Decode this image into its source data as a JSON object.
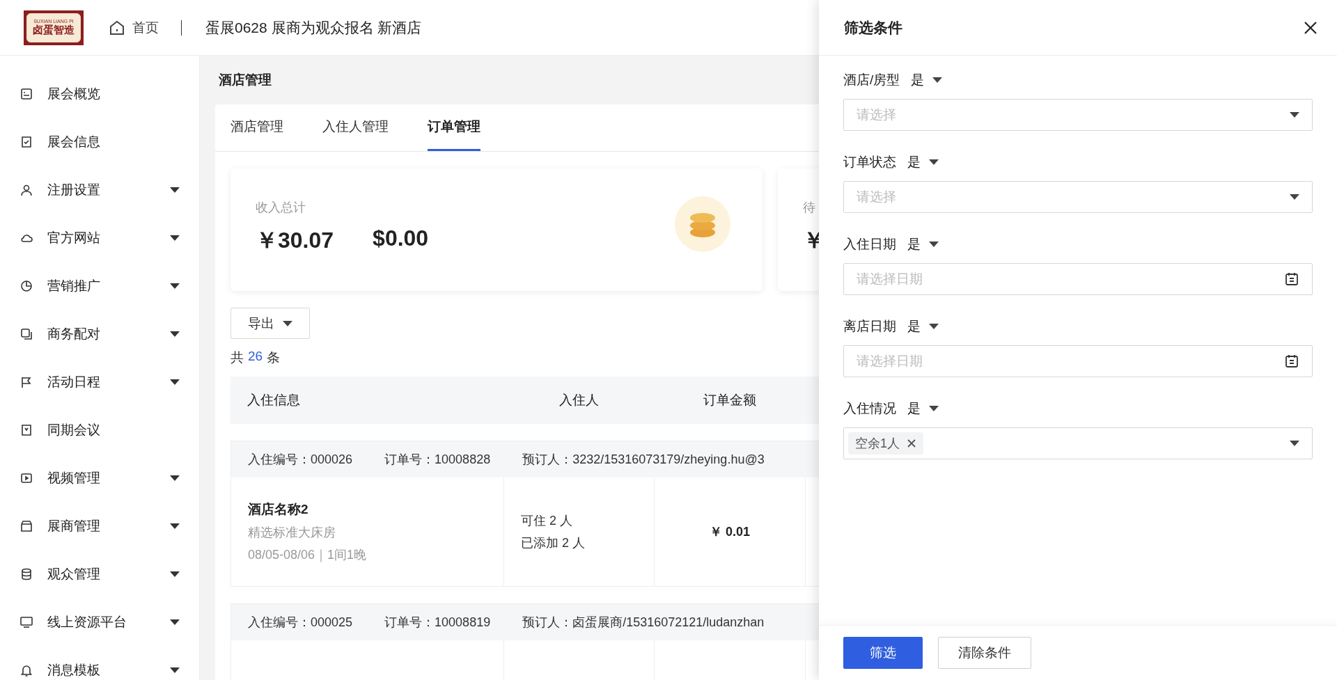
{
  "header": {
    "logo": {
      "arc": "SUXIAN LIANG PI",
      "main": "卤蛋智造"
    },
    "home": "首页",
    "title": "蛋展0628 展商为观众报名 新酒店"
  },
  "sidebar": {
    "items": [
      {
        "label": "展会概览",
        "expandable": false
      },
      {
        "label": "展会信息",
        "expandable": false
      },
      {
        "label": "注册设置",
        "expandable": true
      },
      {
        "label": "官方网站",
        "expandable": true
      },
      {
        "label": "营销推广",
        "expandable": true
      },
      {
        "label": "商务配对",
        "expandable": true
      },
      {
        "label": "活动日程",
        "expandable": true
      },
      {
        "label": "同期会议",
        "expandable": false
      },
      {
        "label": "视频管理",
        "expandable": true
      },
      {
        "label": "展商管理",
        "expandable": true
      },
      {
        "label": "观众管理",
        "expandable": true
      },
      {
        "label": "线上资源平台",
        "expandable": true
      },
      {
        "label": "消息模板",
        "expandable": true
      }
    ]
  },
  "page_title": "酒店管理",
  "tabs": [
    {
      "label": "酒店管理",
      "selected": false
    },
    {
      "label": "入住人管理",
      "selected": false
    },
    {
      "label": "订单管理",
      "selected": true
    }
  ],
  "stats": [
    {
      "label": "收入总计",
      "values": [
        "￥30.07",
        "$0.00"
      ]
    },
    {
      "label": "待",
      "values": [
        "￥"
      ]
    }
  ],
  "export_button": "导出",
  "count": {
    "prefix": "共",
    "value": "26",
    "suffix": "条"
  },
  "table": {
    "columns": [
      "入住信息",
      "入住人",
      "订单金额"
    ],
    "orders": [
      {
        "checkin_no_label": "入住编号：",
        "checkin_no": "000026",
        "order_no_label": "订单号：",
        "order_no": "10008828",
        "booker_label": "预订人：",
        "booker": "3232/15316073179/zheying.hu@3",
        "hotel": "酒店名称2",
        "room": "精选标准大床房",
        "dates": "08/05-08/06｜1间1晚",
        "capacity": "可住 2 人",
        "added": "已添加 2 人",
        "amount": "￥ 0.01"
      },
      {
        "checkin_no_label": "入住编号：",
        "checkin_no": "000025",
        "order_no_label": "订单号：",
        "order_no": "10008819",
        "booker_label": "预订人：",
        "booker": "卤蛋展商/15316072121/ludanzhan"
      }
    ]
  },
  "filter_drawer": {
    "title": "筛选条件",
    "filters": [
      {
        "kind": "select",
        "label": "酒店/房型",
        "operator": "是",
        "placeholder": "请选择"
      },
      {
        "kind": "select",
        "label": "订单状态",
        "operator": "是",
        "placeholder": "请选择"
      },
      {
        "kind": "date",
        "label": "入住日期",
        "operator": "是",
        "placeholder": "请选择日期"
      },
      {
        "kind": "date",
        "label": "离店日期",
        "operator": "是",
        "placeholder": "请选择日期"
      },
      {
        "kind": "tags",
        "label": "入住情况",
        "operator": "是",
        "tags": [
          "空余1人"
        ]
      }
    ],
    "buttons": [
      {
        "label": "筛选",
        "kind": "primary"
      },
      {
        "label": "清除条件",
        "kind": "default"
      }
    ]
  }
}
